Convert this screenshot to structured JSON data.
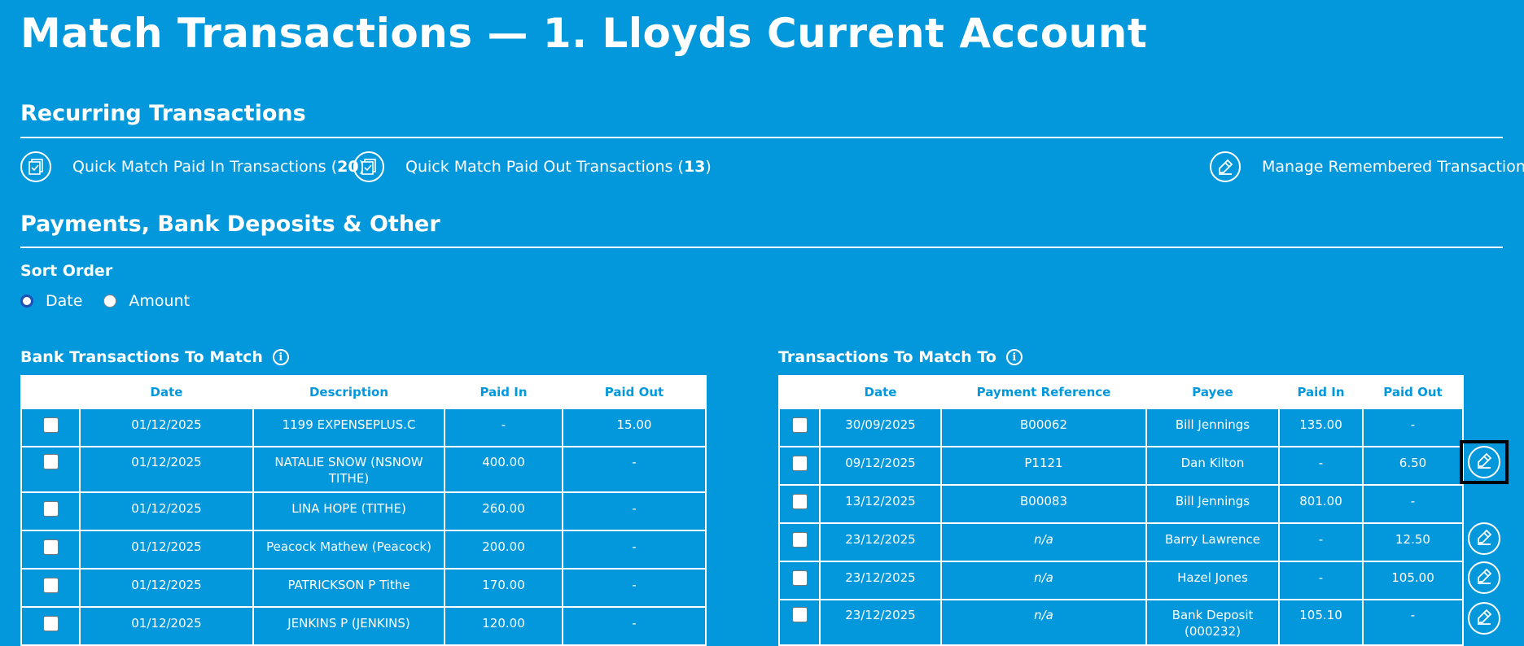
{
  "page": {
    "title": "Match Transactions — 1. Lloyds Current Account"
  },
  "recurring": {
    "title": "Recurring Transactions",
    "quick_in": {
      "label": "Quick Match Paid In Transactions (",
      "count": "20",
      "suffix": ")"
    },
    "quick_out": {
      "label": "Quick Match Paid Out Transactions (",
      "count": "13",
      "suffix": ")"
    },
    "manage_label": "Manage Remembered Transactions"
  },
  "payments": {
    "title": "Payments, Bank Deposits & Other",
    "sort_label": "Sort Order",
    "sort_options": [
      "Date",
      "Amount"
    ],
    "sort_selected": "Date"
  },
  "bank_table": {
    "title": "Bank Transactions To Match",
    "columns": [
      "Date",
      "Description",
      "Paid In",
      "Paid Out"
    ],
    "rows": [
      {
        "date": "01/12/2025",
        "description": "1199 EXPENSEPLUS.C",
        "paid_in": "-",
        "paid_out": "15.00"
      },
      {
        "date": "01/12/2025",
        "description": "NATALIE SNOW (NSNOW TITHE)",
        "paid_in": "400.00",
        "paid_out": "-"
      },
      {
        "date": "01/12/2025",
        "description": "LINA HOPE (TITHE)",
        "paid_in": "260.00",
        "paid_out": "-"
      },
      {
        "date": "01/12/2025",
        "description": "Peacock Mathew (Peacock)",
        "paid_in": "200.00",
        "paid_out": "-"
      },
      {
        "date": "01/12/2025",
        "description": "PATRICKSON P Tithe",
        "paid_in": "170.00",
        "paid_out": "-"
      },
      {
        "date": "01/12/2025",
        "description": "JENKINS P (JENKINS)",
        "paid_in": "120.00",
        "paid_out": "-"
      }
    ]
  },
  "match_table": {
    "title": "Transactions To Match To",
    "columns": [
      "Date",
      "Payment Reference",
      "Payee",
      "Paid In",
      "Paid Out"
    ],
    "rows": [
      {
        "date": "30/09/2025",
        "reference": "B00062",
        "payee": "Bill Jennings",
        "paid_in": "135.00",
        "paid_out": "-"
      },
      {
        "date": "09/12/2025",
        "reference": "P1121",
        "payee": "Dan Kilton",
        "paid_in": "-",
        "paid_out": "6.50"
      },
      {
        "date": "13/12/2025",
        "reference": "B00083",
        "payee": "Bill Jennings",
        "paid_in": "801.00",
        "paid_out": "-"
      },
      {
        "date": "23/12/2025",
        "reference": "n/a",
        "payee": "Barry Lawrence",
        "paid_in": "-",
        "paid_out": "12.50"
      },
      {
        "date": "23/12/2025",
        "reference": "n/a",
        "payee": "Hazel Jones",
        "paid_in": "-",
        "paid_out": "105.00"
      },
      {
        "date": "23/12/2025",
        "reference": "n/a",
        "payee": "Bank Deposit (000232)",
        "paid_in": "105.10",
        "paid_out": "-"
      }
    ]
  },
  "icons": {
    "quick_match": "checklist-icon",
    "edit": "edit-pencil-icon",
    "info": "info-icon"
  },
  "colors": {
    "background": "#0398dc",
    "text": "#ffffff",
    "focus": "#000000"
  }
}
